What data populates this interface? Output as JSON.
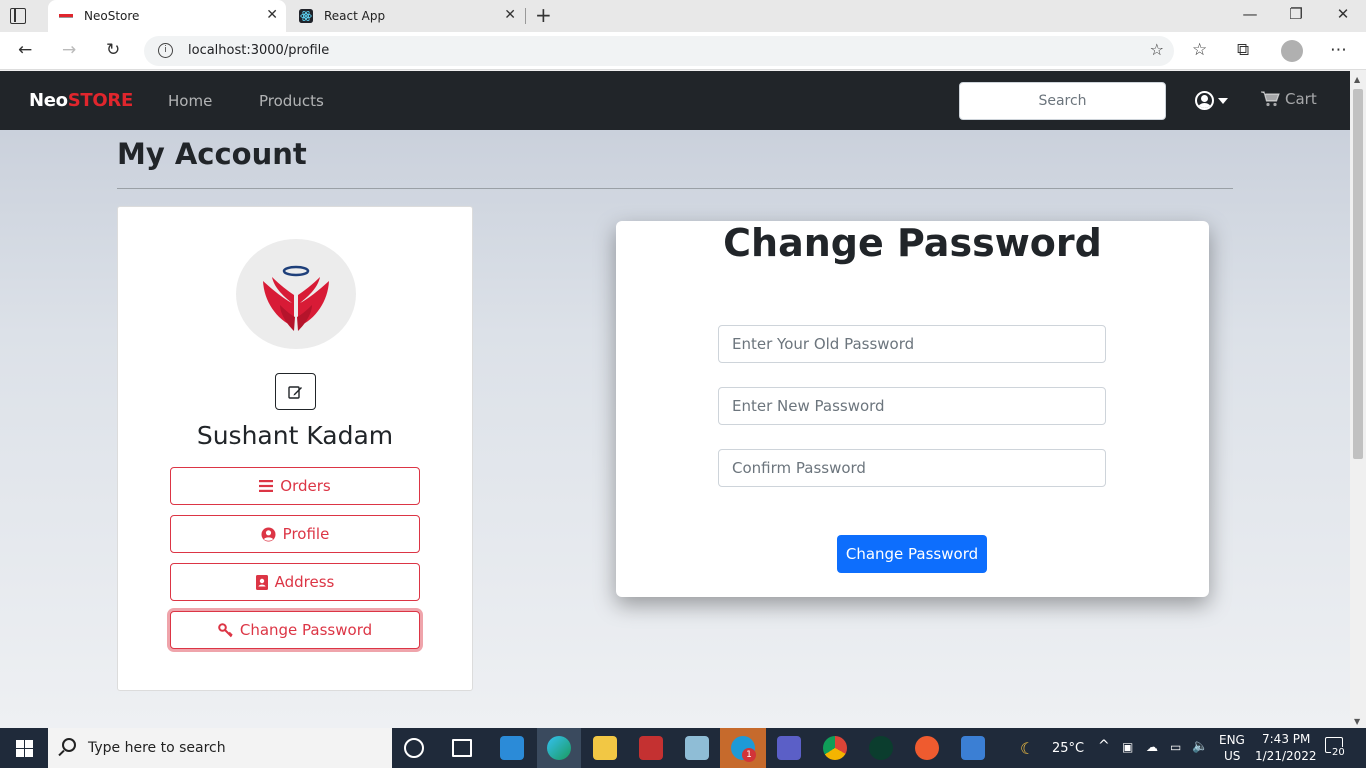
{
  "browser": {
    "tabs": [
      {
        "title": "NeoStore",
        "active": true
      },
      {
        "title": "React App",
        "active": false
      }
    ],
    "url": "localhost:3000/profile"
  },
  "navbar": {
    "brand_neo": "Neo",
    "brand_store": "STORE",
    "links": [
      "Home",
      "Products"
    ],
    "search_placeholder": "Search",
    "cart_label": "Cart"
  },
  "page": {
    "title": "My Account"
  },
  "sidebar": {
    "user_name": "Sushant Kadam",
    "menu": [
      {
        "label": "Orders",
        "icon": "bars-icon"
      },
      {
        "label": "Profile",
        "icon": "user-circle-icon"
      },
      {
        "label": "Address",
        "icon": "address-card-icon"
      },
      {
        "label": "Change Password",
        "icon": "key-icon",
        "focused": true
      }
    ]
  },
  "form": {
    "title": "Change Password",
    "old_password_placeholder": "Enter Your Old Password",
    "new_password_placeholder": "Enter New Password",
    "confirm_password_placeholder": "Confirm Password",
    "submit_label": "Change Password"
  },
  "taskbar": {
    "search_placeholder": "Type here to search",
    "weather": "25°C",
    "language_top": "ENG",
    "language_bottom": "US",
    "time": "7:43 PM",
    "date": "1/21/2022",
    "notifications": "20",
    "skype_badge": "1"
  },
  "colors": {
    "navbar_bg": "#212529",
    "brand_red": "#e0262d",
    "danger": "#dc3545",
    "primary": "#0d6efd"
  }
}
